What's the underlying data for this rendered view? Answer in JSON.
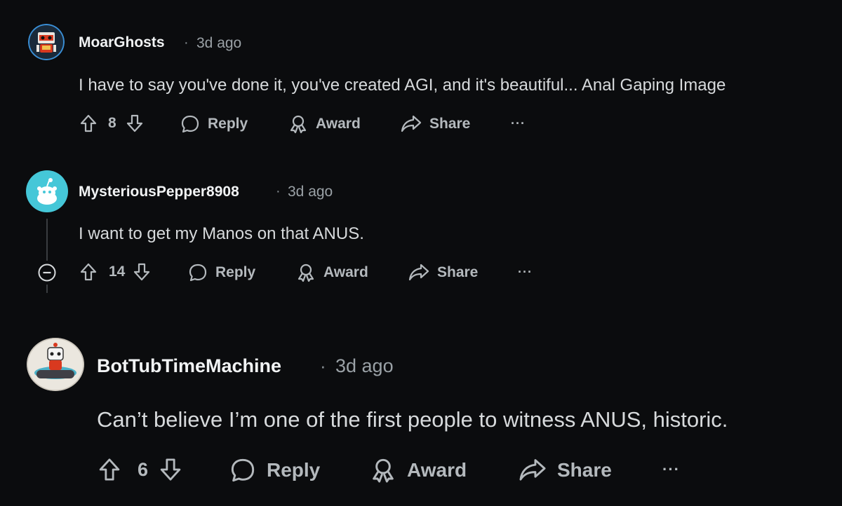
{
  "comments": [
    {
      "username": "MoarGhosts",
      "separator": "·",
      "time": "3d ago",
      "text": "I have to say you've done it, you've created AGI, and it's beautiful... Anal Gaping Image",
      "score": "8",
      "reply_label": "Reply",
      "award_label": "Award",
      "share_label": "Share",
      "more_label": "···"
    },
    {
      "username": "MysteriousPepper8908",
      "separator": "·",
      "time": "3d ago",
      "text": "I want to get my Manos on that ANUS.",
      "score": "14",
      "reply_label": "Reply",
      "award_label": "Award",
      "share_label": "Share",
      "more_label": "···"
    },
    {
      "username": "BotTubTimeMachine",
      "separator": "·",
      "time": "3d ago",
      "text": "Can’t believe I’m one of the first people to witness ANUS, historic.",
      "score": "6",
      "reply_label": "Reply",
      "award_label": "Award",
      "share_label": "Share",
      "more_label": "···"
    }
  ],
  "colors": {
    "background": "#0b0c0e",
    "text": "#d7dadc",
    "muted": "#9aa1a6",
    "avatar_teal": "#45c7d8",
    "avatar_ring_blue": "#3a8fd6"
  }
}
